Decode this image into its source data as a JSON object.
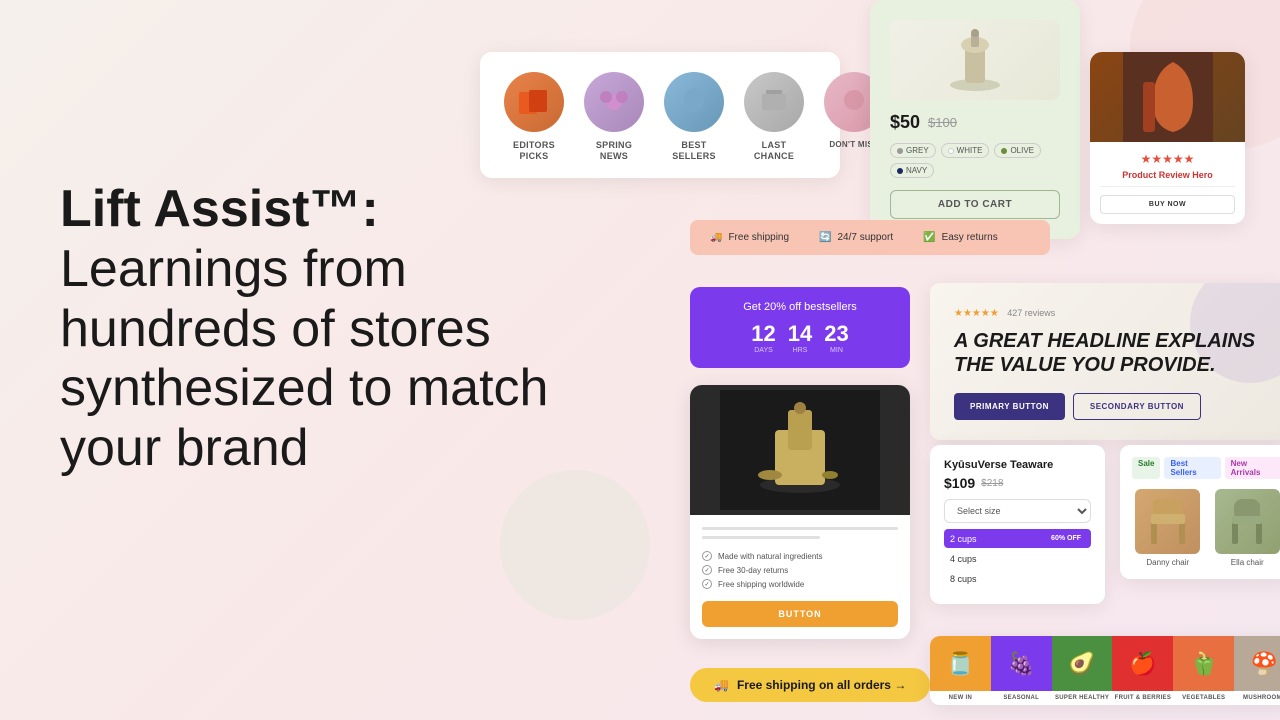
{
  "hero": {
    "title": "Lift Assist™:",
    "subtitle": "Learnings from hundreds of stores synthesized to match your brand"
  },
  "categories": {
    "items": [
      {
        "label": "EDITORS\nPICKS",
        "color": "orange"
      },
      {
        "label": "SPRING\nNEWS",
        "color": "lavender"
      },
      {
        "label": "BEST\nSELLERS",
        "color": "blue"
      },
      {
        "label": "LAST\nCHANCE",
        "color": "gray"
      },
      {
        "label": "DON'T\nMISS",
        "color": "pink"
      }
    ]
  },
  "product_price": {
    "price_current": "$50",
    "price_old": "$100",
    "colors": [
      "GREY",
      "WHITE",
      "OLIVE",
      "NAVY"
    ],
    "cta": "ADD TO CART"
  },
  "review_hero": {
    "stars": "★★★★★",
    "title": "Product Review Hero",
    "cta": "BUY NOW"
  },
  "shipping_banner": {
    "items": [
      "Free shipping",
      "24/7 support",
      "Easy returns"
    ]
  },
  "countdown": {
    "title": "Get 20% off bestsellers",
    "days": "12",
    "hours": "14",
    "mins": "23",
    "labels": [
      "DAYS",
      "HRS",
      "MIN"
    ]
  },
  "product_detail": {
    "features": [
      "Made with natural ingredients",
      "Free 30-day returns",
      "Free shipping worldwide"
    ],
    "cta": "BUTTON"
  },
  "free_shipping_footer": {
    "label": "Free shipping on all orders →"
  },
  "hero_banner": {
    "stars": "★★★★★",
    "review_count": "427 reviews",
    "headline": "A GREAT HEADLINE EXPLAINS\nTHE VALUE YOU PROVIDE.",
    "primary_btn": "PRIMARY BUTTON",
    "secondary_btn": "SECONDARY BUTTON"
  },
  "teaware": {
    "name": "KyūsuVerse Teaware",
    "price_current": "$109",
    "price_old": "$218",
    "select_label": "Select size",
    "options": [
      "2 cups",
      "4 cups",
      "8 cups"
    ],
    "discount": "60% OFF"
  },
  "chairs": {
    "tags": [
      "Sale",
      "Best Sellers",
      "New Arrivals"
    ],
    "items": [
      {
        "name": "Danny chair"
      },
      {
        "name": "Ella chair"
      }
    ]
  },
  "food_grid": {
    "items": [
      {
        "label": "NEW IN",
        "emoji": "🫙"
      },
      {
        "label": "SEASONAL",
        "emoji": "🍇"
      },
      {
        "label": "SUPER HEALTHY",
        "emoji": "🥑"
      },
      {
        "label": "FRUIT & BERRIES",
        "emoji": "🍎"
      },
      {
        "label": "VEGETABLES",
        "emoji": "🫑"
      },
      {
        "label": "MUSHROOMS",
        "emoji": "🍄"
      }
    ]
  }
}
